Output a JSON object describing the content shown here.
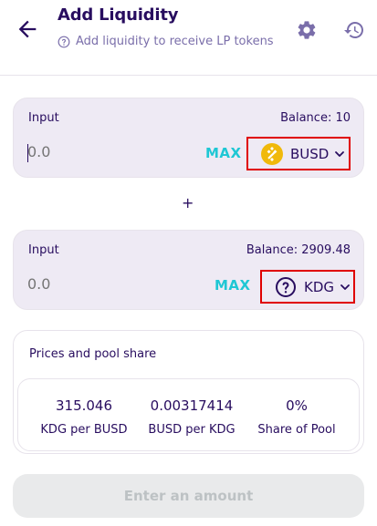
{
  "header": {
    "title": "Add Liquidity",
    "subtitle": "Add liquidity to receive LP tokens",
    "icons": {
      "back": "arrow-left-icon",
      "settings": "gear-icon",
      "history": "history-icon",
      "help": "question-circle-icon"
    }
  },
  "input_a": {
    "label": "Input",
    "balance": "Balance: 10",
    "placeholder": "0.0",
    "max_label": "MAX",
    "token": {
      "symbol": "BUSD",
      "icon": "busd-token-icon",
      "color": "#f0b90b"
    }
  },
  "plus_sign": "+",
  "input_b": {
    "label": "Input",
    "balance": "Balance: 2909.48",
    "placeholder": "0.0",
    "max_label": "MAX",
    "token": {
      "symbol": "KDG",
      "icon": "question-circle-icon"
    }
  },
  "prices": {
    "title": "Prices and pool share",
    "stats": [
      {
        "value": "315.046",
        "label": "KDG per BUSD"
      },
      {
        "value": "0.00317414",
        "label": "BUSD per KDG"
      },
      {
        "value": "0%",
        "label": "Share of Pool"
      }
    ]
  },
  "action": {
    "label": "Enter an amount"
  },
  "colors": {
    "accent": "#1fc7d4",
    "text": "#280d5f",
    "secondary": "#7a6eaa",
    "panel": "#eeeaf4",
    "highlight": "#e00000"
  }
}
